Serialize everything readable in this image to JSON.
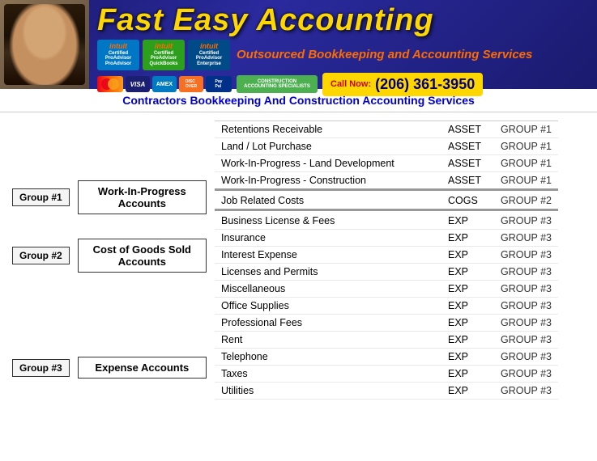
{
  "header": {
    "company_title": "Fast Easy Accounting",
    "outsourced_text": "Outsourced Bookkeeping and Accounting Services",
    "call_label": "Call Now:",
    "call_number": "(206) 361-3950",
    "intuit_badges": [
      {
        "logo": "intuit",
        "line1": "Certified",
        "line2": "ProAdvisor",
        "line3": "ProAdvisor"
      },
      {
        "logo": "intuit",
        "line1": "Certified",
        "line2": "ProAdvisor",
        "line3": "QuickBooks"
      },
      {
        "logo": "intuit",
        "line1": "Certified",
        "line2": "ProAdvisor",
        "line3": "Enterprise"
      }
    ]
  },
  "sub_header": {
    "text": "Contractors Bookkeeping And Construction Accounting Services"
  },
  "groups": [
    {
      "label": "Group #1",
      "name": "Work-In-Progress Accounts"
    },
    {
      "label": "Group #2",
      "name": "Cost of Goods Sold Accounts"
    },
    {
      "label": "Group #3",
      "name": "Expense Accounts"
    }
  ],
  "accounts": [
    {
      "name": "Retentions Receivable",
      "type": "ASSET",
      "group": "GROUP #1"
    },
    {
      "name": "Land / Lot Purchase",
      "type": "ASSET",
      "group": "GROUP #1"
    },
    {
      "name": "Work-In-Progress - Land Development",
      "type": "ASSET",
      "group": "GROUP #1"
    },
    {
      "name": "Work-In-Progress - Construction",
      "type": "ASSET",
      "group": "GROUP #1"
    },
    {
      "name": "Job Related Costs",
      "type": "COGS",
      "group": "GROUP #2"
    },
    {
      "name": "Business License & Fees",
      "type": "EXP",
      "group": "GROUP #3"
    },
    {
      "name": "Insurance",
      "type": "EXP",
      "group": "GROUP #3"
    },
    {
      "name": "Interest Expense",
      "type": "EXP",
      "group": "GROUP #3"
    },
    {
      "name": "Licenses and Permits",
      "type": "EXP",
      "group": "GROUP #3"
    },
    {
      "name": "Miscellaneous",
      "type": "EXP",
      "group": "GROUP #3"
    },
    {
      "name": "Office Supplies",
      "type": "EXP",
      "group": "GROUP #3"
    },
    {
      "name": "Professional Fees",
      "type": "EXP",
      "group": "GROUP #3"
    },
    {
      "name": "Rent",
      "type": "EXP",
      "group": "GROUP #3"
    },
    {
      "name": "Telephone",
      "type": "EXP",
      "group": "GROUP #3"
    },
    {
      "name": "Taxes",
      "type": "EXP",
      "group": "GROUP #3"
    },
    {
      "name": "Utilities",
      "type": "EXP",
      "group": "GROUP #3"
    }
  ]
}
